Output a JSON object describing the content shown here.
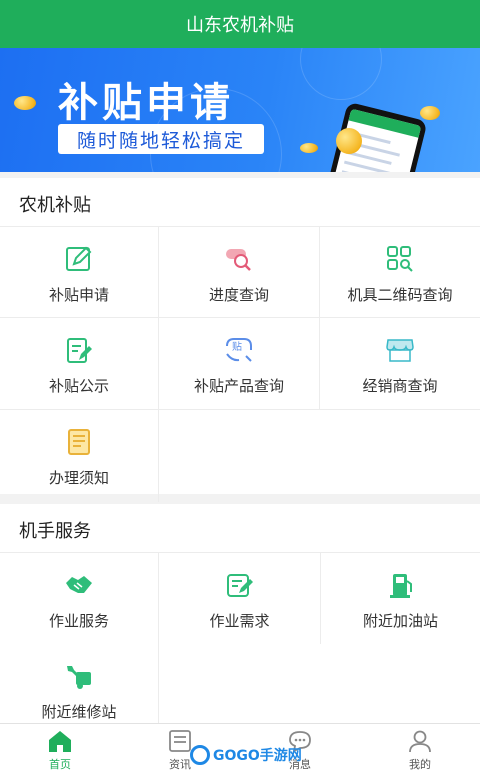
{
  "header": {
    "title": "山东农机补贴"
  },
  "banner": {
    "title": "补贴申请",
    "subtitle": "随时随地轻松搞定"
  },
  "sections": {
    "subsidy": {
      "title": "农机补贴",
      "items": [
        {
          "label": "补贴申请",
          "icon": "edit-icon"
        },
        {
          "label": "进度查询",
          "icon": "progress-search-icon"
        },
        {
          "label": "机具二维码查询",
          "icon": "qr-search-icon"
        },
        {
          "label": "补贴公示",
          "icon": "clipboard-edit-icon"
        },
        {
          "label": "补贴产品查询",
          "icon": "product-search-icon"
        },
        {
          "label": "经销商查询",
          "icon": "store-icon"
        },
        {
          "label": "办理须知",
          "icon": "notice-icon"
        }
      ]
    },
    "operator": {
      "title": "机手服务",
      "items": [
        {
          "label": "作业服务",
          "icon": "handshake-icon"
        },
        {
          "label": "作业需求",
          "icon": "form-edit-icon"
        },
        {
          "label": "附近加油站",
          "icon": "gas-station-icon"
        },
        {
          "label": "附近维修站",
          "icon": "repair-icon"
        }
      ]
    }
  },
  "tabs": [
    {
      "label": "首页",
      "icon": "home-icon",
      "active": true
    },
    {
      "label": "资讯",
      "icon": "news-icon",
      "active": false
    },
    {
      "label": "消息",
      "icon": "message-icon",
      "active": false
    },
    {
      "label": "我的",
      "icon": "user-icon",
      "active": false
    }
  ],
  "watermark": {
    "text": "GOGO手游网"
  },
  "colors": {
    "primary": "#1fae5b",
    "banner": "#1d6ff2"
  }
}
